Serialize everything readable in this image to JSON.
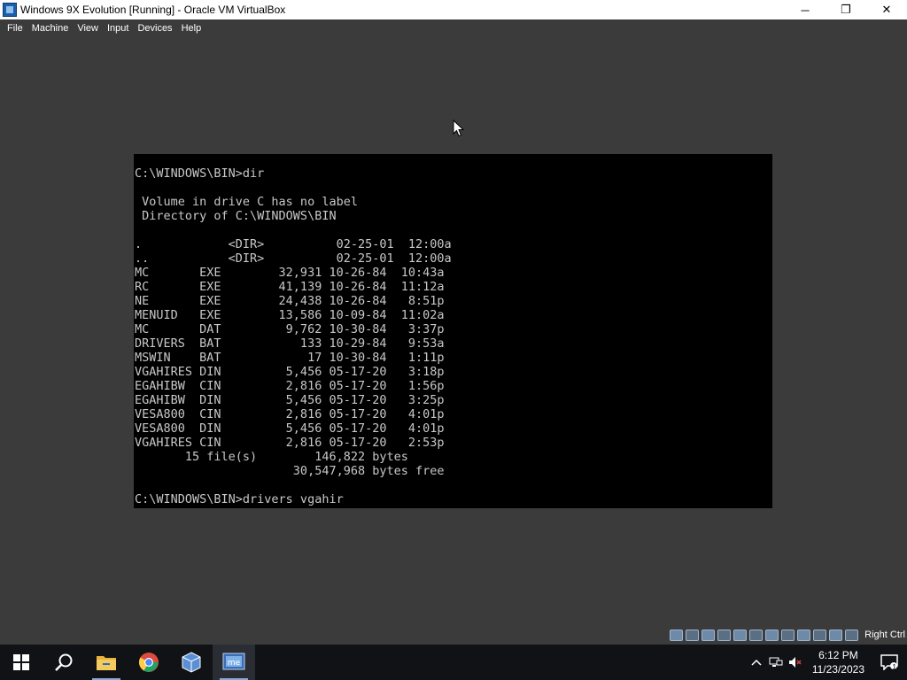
{
  "window": {
    "title": "Windows 9X Evolution [Running] - Oracle VM VirtualBox",
    "minimize": "─",
    "maximize": "❐",
    "close": "✕"
  },
  "menu": [
    "File",
    "Machine",
    "View",
    "Input",
    "Devices",
    "Help"
  ],
  "console": {
    "text": "C:\\WINDOWS\\BIN>dir\n\n Volume in drive C has no label\n Directory of C:\\WINDOWS\\BIN\n\n.            <DIR>          02-25-01  12:00a\n..           <DIR>          02-25-01  12:00a\nMC       EXE        32,931 10-26-84  10:43a\nRC       EXE        41,139 10-26-84  11:12a\nNE       EXE        24,438 10-26-84   8:51p\nMENUID   EXE        13,586 10-09-84  11:02a\nMC       DAT         9,762 10-30-84   3:37p\nDRIVERS  BAT           133 10-29-84   9:53a\nMSWIN    BAT            17 10-30-84   1:11p\nVGAHIRES DIN         5,456 05-17-20   3:18p\nEGAHIBW  CIN         2,816 05-17-20   1:56p\nEGAHIBW  DIN         5,456 05-17-20   3:25p\nVESA800  CIN         2,816 05-17-20   4:01p\nVESA800  DIN         5,456 05-17-20   4:01p\nVGAHIRES CIN         2,816 05-17-20   2:53p\n       15 file(s)        146,822 bytes\n                      30,547,968 bytes free\n\nC:\\WINDOWS\\BIN>drivers vgahir"
  },
  "status_bar": {
    "host_key": "Right Ctrl"
  },
  "taskbar": {
    "apps": [
      "start-icon",
      "search-icon",
      "file-explorer-icon",
      "chrome-icon",
      "virtualbox-icon",
      "windows-me-vm-icon"
    ]
  },
  "clock": {
    "time": "6:12 PM",
    "date": "11/23/2023"
  },
  "notifications": {
    "count": "1"
  }
}
